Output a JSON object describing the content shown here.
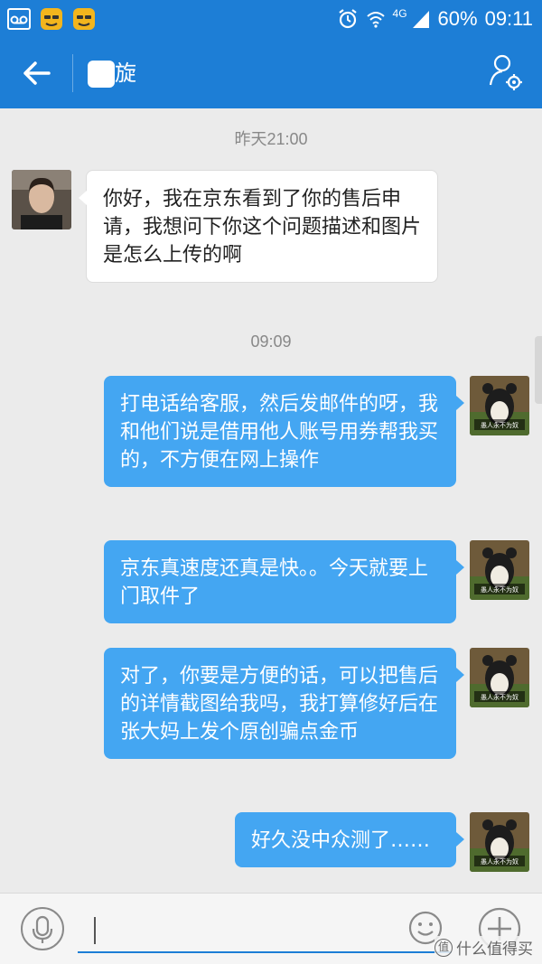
{
  "status_bar": {
    "network": "4G",
    "battery": "60%",
    "time": "09:11"
  },
  "header": {
    "title": "旋"
  },
  "chat": {
    "timestamps": [
      "昨天21:00",
      "09:09"
    ],
    "messages": [
      {
        "from": "contact",
        "text": "你好，我在京东看到了你的售后申请，我想问下你这个问题描述和图片是怎么上传的啊"
      },
      {
        "from": "me",
        "text": "打电话给客服，然后发邮件的呀，我和他们说是借用他人账号用券帮我买的，不方便在网上操作"
      },
      {
        "from": "me",
        "text": "京东真速度还真是快。。今天就要上门取件了"
      },
      {
        "from": "me",
        "text": "对了，你要是方便的话，可以把售后的详情截图给我吗，我打算修好后在张大妈上发个原创骗点金币"
      },
      {
        "from": "me",
        "text": "好久没中众测了……"
      }
    ],
    "my_avatar_caption": "愚人永不为奴"
  },
  "input": {
    "value": ""
  },
  "watermark": {
    "text": "什么值得买",
    "badge": "值"
  },
  "colors": {
    "header": "#1d7ed6",
    "outgoing_bubble": "#44a6f2",
    "incoming_bubble": "#ffffff",
    "background": "#ebebeb"
  }
}
